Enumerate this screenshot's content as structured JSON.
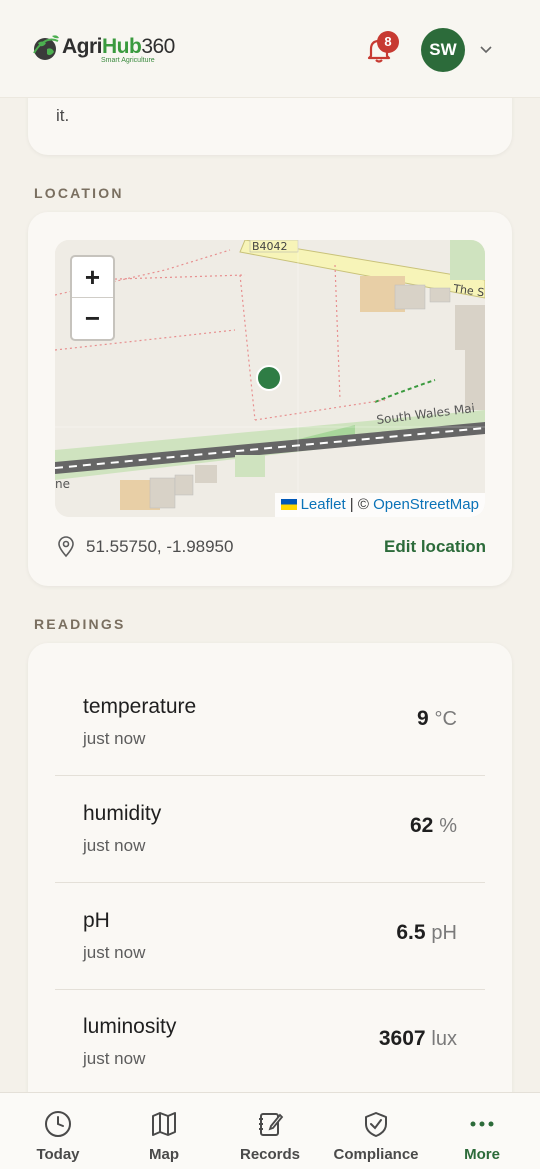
{
  "header": {
    "logo": {
      "agri": "Agri",
      "hub": "Hub",
      "num": "360",
      "tagline": "Smart Agriculture"
    },
    "notifications_count": "8",
    "avatar_initials": "SW"
  },
  "top_card": {
    "text": "it."
  },
  "location": {
    "section_label": "LOCATION",
    "map": {
      "zoom_in": "+",
      "zoom_out": "−",
      "road_label_1": "B4042",
      "road_label_2": "The S",
      "road_label_3": "South Wales Mai",
      "edge_label": "ne",
      "attribution_leaflet": "Leaflet",
      "attribution_sep": "| ©",
      "attribution_osm": "OpenStreetMap"
    },
    "coordinates": "51.55750, -1.98950",
    "edit_label": "Edit location"
  },
  "readings": {
    "section_label": "READINGS",
    "items": [
      {
        "name": "temperature",
        "time": "just now",
        "value": "9",
        "unit": "°C"
      },
      {
        "name": "humidity",
        "time": "just now",
        "value": "62",
        "unit": "%"
      },
      {
        "name": "pH",
        "time": "just now",
        "value": "6.5",
        "unit": "pH"
      },
      {
        "name": "luminosity",
        "time": "just now",
        "value": "3607",
        "unit": "lux"
      }
    ]
  },
  "nav": {
    "items": [
      {
        "label": "Today",
        "icon": "clock-icon"
      },
      {
        "label": "Map",
        "icon": "map-icon"
      },
      {
        "label": "Records",
        "icon": "notebook-icon"
      },
      {
        "label": "Compliance",
        "icon": "shield-check-icon"
      },
      {
        "label": "More",
        "icon": "more-dots-icon"
      }
    ],
    "active": "More"
  },
  "colors": {
    "brand_green": "#2c6b3a",
    "badge_red": "#c73a32",
    "background": "#f4f1ea"
  }
}
